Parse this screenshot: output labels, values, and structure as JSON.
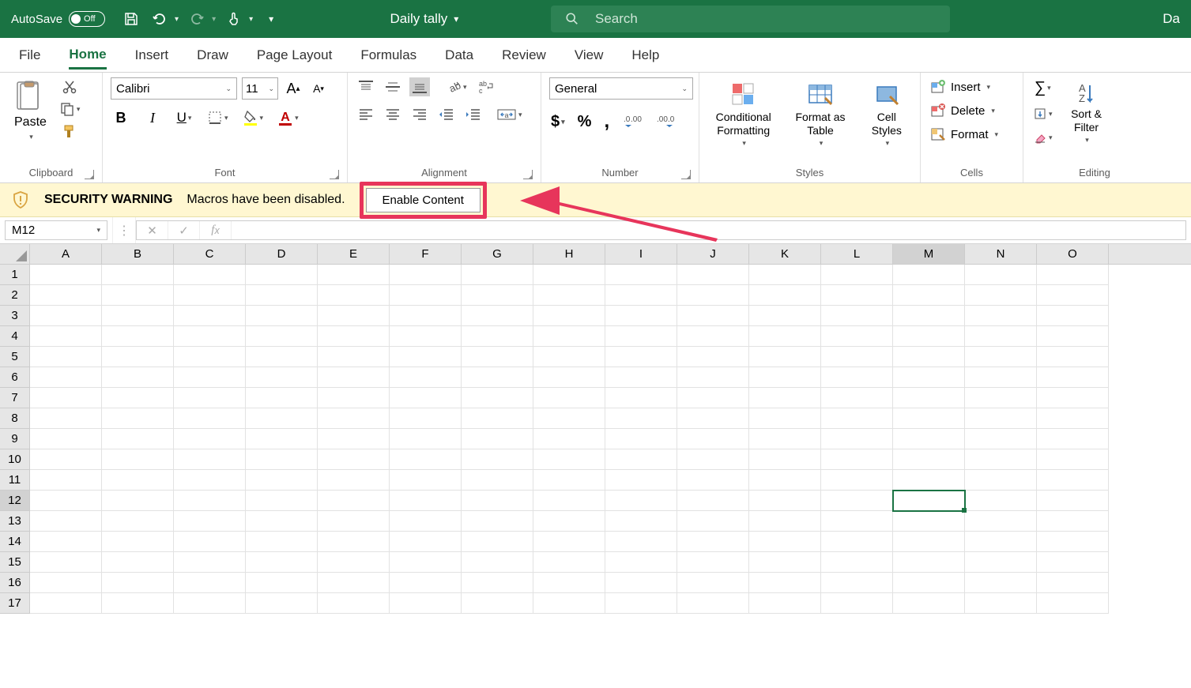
{
  "titlebar": {
    "autosave_label": "AutoSave",
    "autosave_state": "Off",
    "doc_title": "Daily tally",
    "search_placeholder": "Search",
    "right_text": "Da"
  },
  "tabs": [
    "File",
    "Home",
    "Insert",
    "Draw",
    "Page Layout",
    "Formulas",
    "Data",
    "Review",
    "View",
    "Help"
  ],
  "active_tab": "Home",
  "ribbon": {
    "clipboard": {
      "paste": "Paste",
      "label": "Clipboard"
    },
    "font": {
      "name": "Calibri",
      "size": "11",
      "label": "Font"
    },
    "alignment": {
      "label": "Alignment"
    },
    "number": {
      "format": "General",
      "label": "Number"
    },
    "styles": {
      "conditional": "Conditional Formatting",
      "format_table": "Format as Table",
      "cell_styles": "Cell Styles",
      "label": "Styles"
    },
    "cells": {
      "insert": "Insert",
      "delete": "Delete",
      "format": "Format",
      "label": "Cells"
    },
    "editing": {
      "sort": "Sort & Filter",
      "label": "Editing"
    }
  },
  "security": {
    "warning_title": "SECURITY WARNING",
    "warning_msg": "Macros have been disabled.",
    "enable_btn": "Enable Content"
  },
  "namebox": "M12",
  "columns": [
    "A",
    "B",
    "C",
    "D",
    "E",
    "F",
    "G",
    "H",
    "I",
    "J",
    "K",
    "L",
    "M",
    "N",
    "O"
  ],
  "rows": [
    1,
    2,
    3,
    4,
    5,
    6,
    7,
    8,
    9,
    10,
    11,
    12,
    13,
    14,
    15,
    16,
    17
  ],
  "active_cell": {
    "col": "M",
    "row": 12
  }
}
